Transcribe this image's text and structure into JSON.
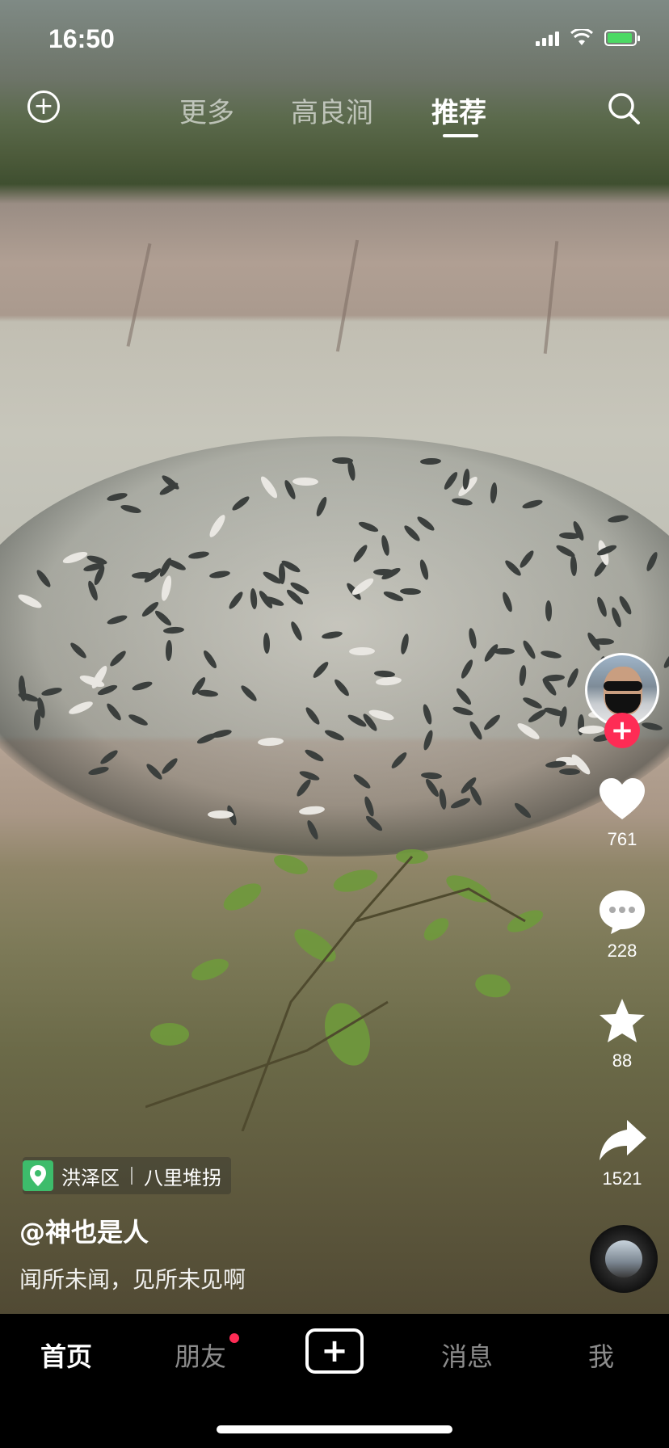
{
  "status_bar": {
    "time": "16:50"
  },
  "top_nav": {
    "tabs": [
      {
        "label": "更多"
      },
      {
        "label": "高良涧"
      },
      {
        "label": "推荐"
      }
    ],
    "active_tab": "推荐"
  },
  "video": {
    "location": {
      "district": "洪泽区",
      "place": "八里堆拐"
    },
    "username": "@神也是人",
    "caption": "闻所未闻，见所未见啊",
    "stats": {
      "likes": "761",
      "comments": "228",
      "favorites": "88",
      "shares": "1521"
    }
  },
  "bottom_nav": {
    "items": [
      {
        "label": "首页"
      },
      {
        "label": "朋友"
      },
      {
        "label": "消息"
      },
      {
        "label": "我"
      }
    ],
    "active": "首页",
    "friends_has_badge": true
  },
  "colors": {
    "accent": "#fe2c55",
    "location_green": "#3dbc6b",
    "battery_green": "#4cd964"
  },
  "icons": [
    "add-icon",
    "search-icon",
    "heart-icon",
    "comment-icon",
    "star-icon",
    "share-icon",
    "location-pin-icon",
    "music-disc-icon",
    "create-icon"
  ]
}
